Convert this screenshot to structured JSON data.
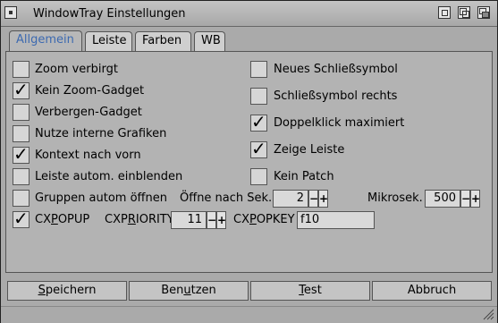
{
  "window": {
    "title": "WindowTray Einstellungen"
  },
  "tabs": [
    "Allgemein",
    "Leiste",
    "Farben",
    "WB"
  ],
  "left_options": [
    {
      "label": "Zoom verbirgt",
      "checked": false
    },
    {
      "label": "Kein Zoom-Gadget",
      "checked": true
    },
    {
      "label": "Verbergen-Gadget",
      "checked": false
    },
    {
      "label": "Nutze interne Grafiken",
      "checked": false
    },
    {
      "label": "Kontext nach vorn",
      "checked": true
    },
    {
      "label": "Leiste autom. einblenden",
      "checked": false
    }
  ],
  "right_options": [
    {
      "label": "Neues Schließsymbol",
      "checked": false
    },
    {
      "label": "Schließsymbol rechts",
      "checked": false
    },
    {
      "label": "Doppelklick maximiert",
      "checked": true
    },
    {
      "label": "Zeige Leiste",
      "checked": true
    },
    {
      "label": "Kein Patch",
      "checked": false
    }
  ],
  "groups": {
    "label": "Gruppen autom öffnen",
    "checked": false,
    "sec_label": "Öffne nach Sek.",
    "sec_value": "2",
    "micro_label": "Mikrosek.",
    "micro_value": "500"
  },
  "cx": {
    "popup_prefix": "CX",
    "popup_ul": "P",
    "popup_suffix": "OPUP",
    "popup_checked": true,
    "priority_prefix": "CXP",
    "priority_ul": "R",
    "priority_suffix": "IORITY",
    "priority_value": "11",
    "key_prefix": "CX",
    "key_ul": "P",
    "key_suffix": "OPKEY",
    "key_value": "f10"
  },
  "spin": {
    "minus": "−",
    "plus": "+"
  },
  "buttons": [
    {
      "pre": "",
      "ul": "S",
      "post": "peichern"
    },
    {
      "pre": "Ben",
      "ul": "u",
      "post": "tzen"
    },
    {
      "pre": "",
      "ul": "T",
      "post": "est"
    },
    {
      "pre": "Abbruch",
      "ul": "",
      "post": ""
    }
  ],
  "check_glyph": "✓"
}
